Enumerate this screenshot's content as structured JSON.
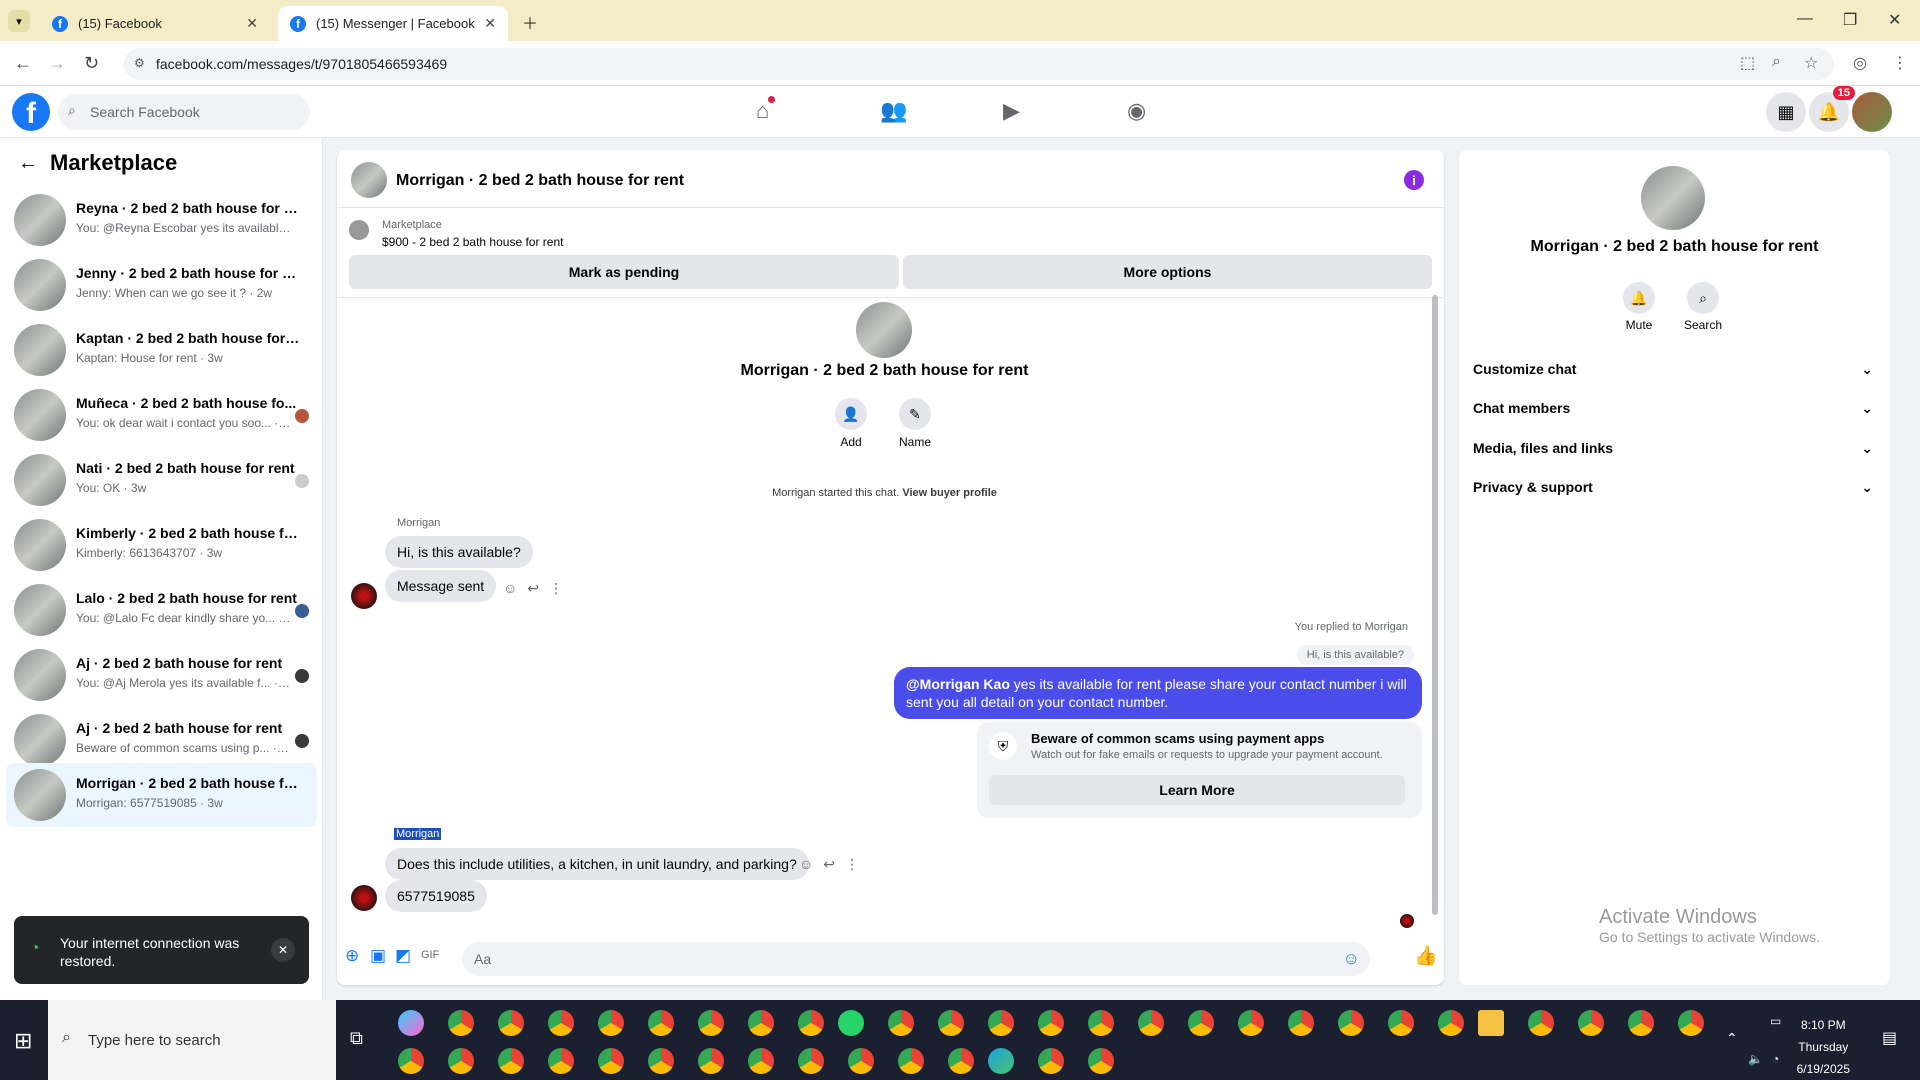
{
  "browser": {
    "tabs": [
      {
        "title": "(15) Facebook"
      },
      {
        "title": "(15) Messenger | Facebook"
      }
    ],
    "url": "facebook.com/messages/t/9701805466593469"
  },
  "fb": {
    "search_placeholder": "Search Facebook",
    "notifications_count": "15"
  },
  "sidebar": {
    "title": "Marketplace",
    "conversations": [
      {
        "name": "Reyna · 2 bed 2 bath house for rent",
        "preview": "You: @Reyna Escobar yes its available... · 2w"
      },
      {
        "name": "Jenny · 2 bed 2 bath house for rent",
        "preview": "Jenny: When can we go see it ? · 2w"
      },
      {
        "name": "Kaptan · 2 bed 2 bath house for rent",
        "preview": "Kaptan: House for rent · 3w"
      },
      {
        "name": "Muñeca · 2 bed 2 bath house fo...",
        "preview": "You: ok dear wait i contact you soo... · 3w"
      },
      {
        "name": "Nati · 2 bed 2 bath house for rent",
        "preview": "You: OK · 3w"
      },
      {
        "name": "Kimberly · 2 bed 2 bath house for ...",
        "preview": "Kimberly: 6613643707 · 3w"
      },
      {
        "name": "Lalo · 2 bed 2 bath house for rent",
        "preview": "You: @Lalo Fc dear kindly share yo... · 3w"
      },
      {
        "name": "Aj · 2 bed 2 bath house for rent",
        "preview": "You: @Aj Merola yes its available f... · 3w"
      },
      {
        "name": "Aj · 2 bed 2 bath house for rent",
        "preview": "Beware of common scams using p... · 3w"
      },
      {
        "name": "Morrigan · 2 bed 2 bath house for ...",
        "preview": "Morrigan: 6577519085 · 3w"
      }
    ]
  },
  "toast": {
    "message": "Your internet connection was restored."
  },
  "chat": {
    "title": "Morrigan · 2 bed 2 bath house for rent",
    "listing_source": "Marketplace",
    "listing": "$900 - 2 bed 2 bath house for rent",
    "mark_pending": "Mark as pending",
    "more_options": "More options",
    "profile_name": "Morrigan · 2 bed 2 bath house for rent",
    "add_label": "Add",
    "name_label": "Name",
    "started_text": "Morrigan started this chat.",
    "view_buyer": "View buyer profile",
    "sender": "Morrigan",
    "msg1": "Hi, is this available?",
    "msg2": "Message sent",
    "replied_to": "You replied to Morrigan",
    "reply_ref": "Hi, is this available?",
    "out_mention": "@Morrigan Kao",
    "out_text": " yes its available for rent please share your contact number i will sent you all detail on your contact number.",
    "scam_title": "Beware of common scams using payment apps",
    "scam_sub": "Watch out for fake emails or requests to upgrade your payment account.",
    "learn_more": "Learn More",
    "sender2": "Morrigan",
    "msg3": "Does this include utilities, a kitchen, in unit laundry, and parking?",
    "msg4": "6577519085",
    "composer_placeholder": "Aa"
  },
  "right_panel": {
    "name": "Morrigan · 2 bed 2 bath house for rent",
    "mute": "Mute",
    "search": "Search",
    "sections": [
      "Customize chat",
      "Chat members",
      "Media, files and links",
      "Privacy & support"
    ]
  },
  "watermark": {
    "title": "Activate Windows",
    "sub": "Go to Settings to activate Windows."
  },
  "taskbar": {
    "search_placeholder": "Type here to search",
    "time": "8:10 PM",
    "day": "Thursday",
    "date": "6/19/2025"
  },
  "colors": {
    "accent": "#1877f2",
    "out_bubble": "#4a4dea"
  }
}
